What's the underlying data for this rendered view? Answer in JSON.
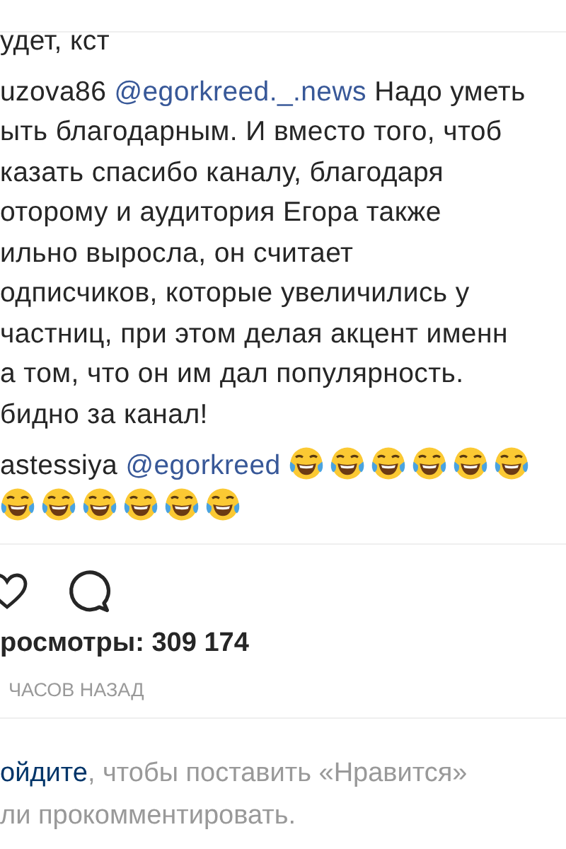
{
  "comments": [
    {
      "lines": [
        "удет, кст"
      ]
    },
    {
      "username": "uzova86",
      "mention": "@egorkreed._.news",
      "lines": [
        "Надо уметь",
        "ыть благодарным. И вместо того, чтоб",
        "казать спасибо каналу, благодаря",
        "оторому и аудитория Егора также",
        "ильно выросла, он считает",
        "одписчиков, которые увеличились у",
        "частниц, при этом делая акцент именн",
        "а том, что он им дал популярность.",
        "бидно за канал!"
      ]
    },
    {
      "username": "astessiya",
      "mention": "@egorkreed",
      "emojis": [
        {
          "kind": "tears-of-joy"
        },
        {
          "kind": "tears-of-joy"
        },
        {
          "kind": "tears-of-joy"
        },
        {
          "kind": "tears-of-joy"
        },
        {
          "kind": "tears-of-joy"
        },
        {
          "kind": "tears-of-joy"
        },
        {
          "kind": "tears-of-joy"
        },
        {
          "kind": "tears-of-joy"
        },
        {
          "kind": "tears-of-joy"
        },
        {
          "kind": "tears-of-joy"
        },
        {
          "kind": "tears-of-joy"
        },
        {
          "kind": "tears-of-joy"
        }
      ]
    }
  ],
  "views": "росмотры: 309 174",
  "time": "ЧАСОВ НАЗАД",
  "login_prompt": {
    "link": "ойдите",
    "text_first_line": ", чтобы поставить «Нравится»",
    "text_second_line": "ли прокомментировать."
  }
}
